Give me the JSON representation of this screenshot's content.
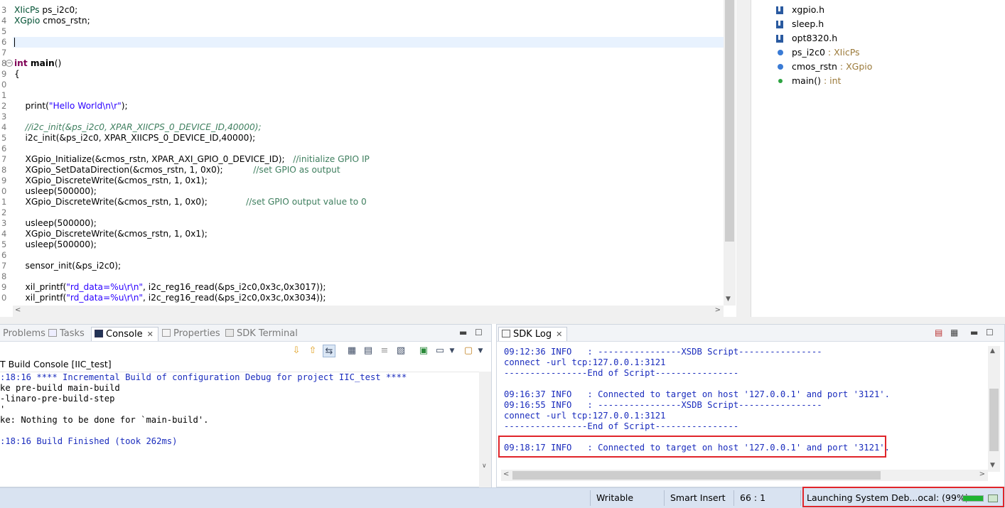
{
  "editor": {
    "line_numbers": [
      "3",
      "4",
      "5",
      "6",
      "7",
      "8",
      "9",
      "0",
      "1",
      "2",
      "3",
      "4",
      "5",
      "6",
      "7",
      "8",
      "9",
      "0",
      "1",
      "2",
      "3",
      "4",
      "5",
      "6",
      "7",
      "8",
      "9",
      "0"
    ],
    "lines": {
      "l3": {
        "type": "XIicPs",
        "rest": " ps_i2c0;"
      },
      "l4": {
        "type": "XGpio",
        "rest": " cmos_rstn;"
      },
      "l8": {
        "kw": "int",
        "fn": " main",
        "rest": "()"
      },
      "l9": "{",
      "l12": {
        "a": "    print(",
        "s": "\"Hello World\\n\\r\"",
        "b": ");"
      },
      "l14": "    //i2c_init(&ps_i2c0, XPAR_XIICPS_0_DEVICE_ID,40000);",
      "l15": "    i2c_init(&ps_i2c0, XPAR_XIICPS_0_DEVICE_ID,40000);",
      "l17": {
        "code": "    XGpio_Initialize(&cmos_rstn, XPAR_AXI_GPIO_0_DEVICE_ID);   ",
        "com": "//initialize GPIO IP"
      },
      "l18": {
        "code": "    XGpio_SetDataDirection(&cmos_rstn, 1, 0x0);           ",
        "com": "//set GPIO as output"
      },
      "l19": "    XGpio_DiscreteWrite(&cmos_rstn, 1, 0x1);",
      "l20": "    usleep(500000);",
      "l21": {
        "code": "    XGpio_DiscreteWrite(&cmos_rstn, 1, 0x0);              ",
        "com": "//set GPIO output value to 0"
      },
      "l23": "    usleep(500000);",
      "l24": "    XGpio_DiscreteWrite(&cmos_rstn, 1, 0x1);",
      "l25": "    usleep(500000);",
      "l27": "    sensor_init(&ps_i2c0);",
      "l29": {
        "a": "    xil_printf(",
        "s": "\"rd_data=%u\\r\\n\"",
        "b": ", i2c_reg16_read(&ps_i2c0,0x3c,0x3017));"
      },
      "l30": {
        "a": "    xil_printf(",
        "s": "\"rd_data=%u\\r\\n\"",
        "b": ", i2c_reg16_read(&ps_i2c0,0x3c,0x3034));"
      }
    }
  },
  "outline": {
    "items": [
      {
        "name": "xgpio.h",
        "type": "",
        "icon": "header-file-icon"
      },
      {
        "name": "sleep.h",
        "type": "",
        "icon": "header-file-icon"
      },
      {
        "name": "opt8320.h",
        "type": "",
        "icon": "header-file-icon"
      },
      {
        "name": "ps_i2c0",
        "type": " : XIicPs",
        "icon": "variable-icon"
      },
      {
        "name": "cmos_rstn",
        "type": " : XGpio",
        "icon": "variable-icon"
      },
      {
        "name": "main()",
        "type": " : int",
        "icon": "function-icon"
      }
    ]
  },
  "console_panel": {
    "tabs": {
      "problems": "Problems",
      "tasks": "Tasks",
      "console": "Console",
      "properties": "Properties",
      "sdk_terminal": "SDK Terminal"
    },
    "title": "T Build Console [IIC_test]",
    "lines": [
      ":18:16 **** Incremental Build of configuration Debug for project IIC_test ****",
      "ke pre-build main-build",
      "-linaro-pre-build-step",
      "'",
      "ke: Nothing to be done for `main-build'.",
      "",
      ":18:16 Build Finished (took 262ms)"
    ]
  },
  "log_panel": {
    "tab": "SDK Log",
    "lines": [
      "09:12:36 INFO   : ----------------XSDB Script----------------",
      "connect -url tcp:127.0.0.1:3121",
      "----------------End of Script----------------",
      "",
      "09:16:37 INFO   : Connected to target on host '127.0.0.1' and port '3121'.",
      "09:16:55 INFO   : ----------------XSDB Script----------------",
      "connect -url tcp:127.0.0.1:3121",
      "----------------End of Script----------------",
      "",
      "09:18:17 INFO   : Connected to target on host '127.0.0.1' and port '3121'."
    ]
  },
  "statusbar": {
    "writable": "Writable",
    "insert_mode": "Smart Insert",
    "cursor_pos": "66 : 1",
    "progress_text": "Launching System Deb...ocal: (99%)",
    "progress_value": 0.99
  },
  "colors": {
    "highlight_box": "#e0252a",
    "log_text": "#1a2cbd",
    "progress_fill": "#1fb432"
  }
}
